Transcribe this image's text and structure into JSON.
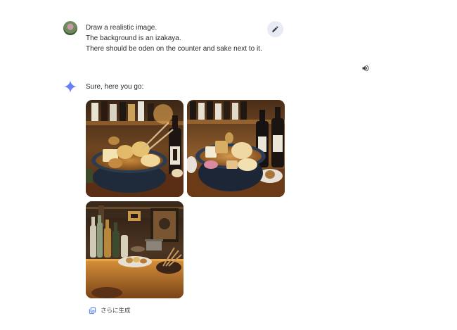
{
  "user_message": {
    "lines": [
      "Draw a realistic image.",
      "The background is an izakaya.",
      "There should be oden on the counter and sake next to it."
    ]
  },
  "icons": {
    "avatar": "user-avatar",
    "edit": "pencil-icon",
    "speaker": "speaker-icon",
    "assistant": "sparkle-icon",
    "more": "image-stack-icon"
  },
  "assistant": {
    "reply_text": "Sure, here you go:",
    "images": [
      {
        "subject": "oden bowl with skewers and sake bottle"
      },
      {
        "subject": "oden bowl with sake bottles"
      },
      {
        "subject": "izakaya counter with oden and sake bottles"
      }
    ],
    "generate_more_label": "さらに生成"
  },
  "colors": {
    "accent_blue": "#4c7cf0",
    "edit_button_bg": "#e8ebf3",
    "text": "#2b2b2b"
  }
}
